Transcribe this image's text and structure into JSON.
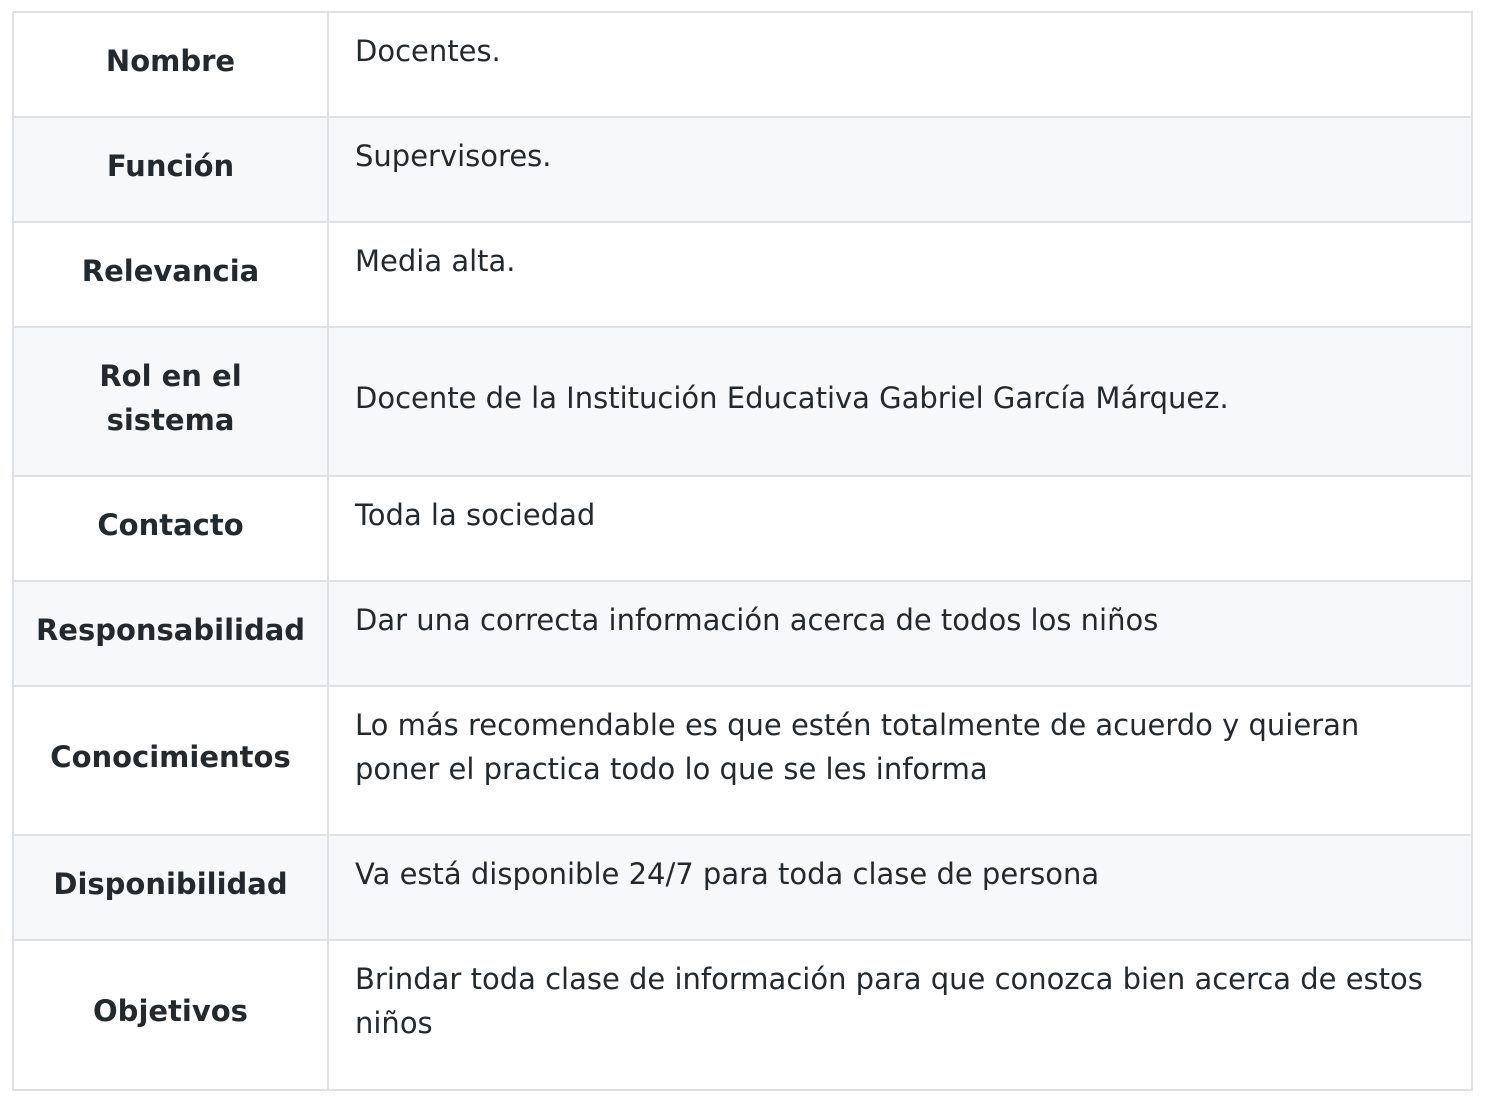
{
  "rows": [
    {
      "label": "Nombre",
      "value": "Docentes."
    },
    {
      "label": "Función",
      "value": "Supervisores."
    },
    {
      "label": "Relevancia",
      "value": "Media alta."
    },
    {
      "label": "Rol en el sistema",
      "value": "Docente de la Institución Educativa Gabriel García Márquez."
    },
    {
      "label": "Contacto",
      "value": "Toda la sociedad"
    },
    {
      "label": "Responsabilidad",
      "value": "Dar una correcta información acerca de todos los niños"
    },
    {
      "label": "Conocimientos",
      "value": "Lo más recomendable es que estén totalmente de acuerdo y quieran poner el practica todo lo que se les informa"
    },
    {
      "label": "Disponibilidad",
      "value": "Va está disponible 24/7 para toda clase de persona"
    },
    {
      "label": "Objetivos",
      "value": "Brindar toda clase de información para que conozca bien acerca de estos niños"
    }
  ]
}
